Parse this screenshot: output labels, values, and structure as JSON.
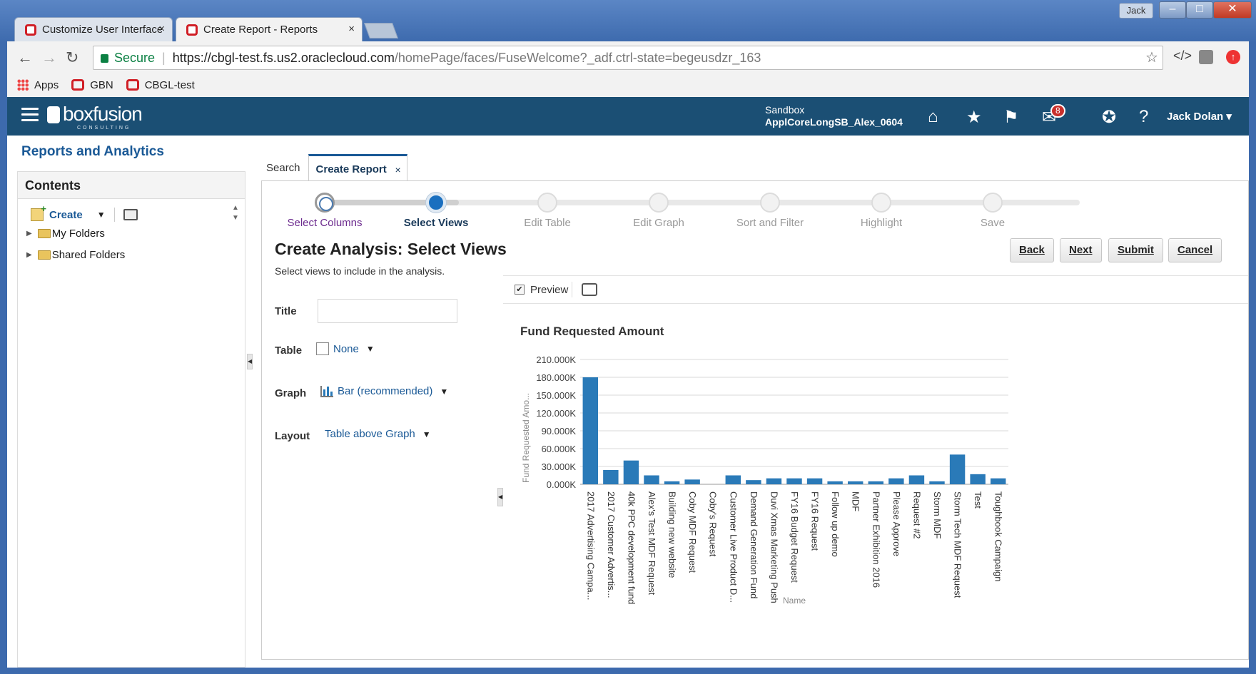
{
  "window": {
    "user_button": "Jack",
    "tabs": [
      {
        "label": "Customize User Interface",
        "close": "×"
      },
      {
        "label": "Create Report - Reports",
        "close": "×"
      }
    ]
  },
  "browser": {
    "secure_label": "Secure",
    "url_host": "https://cbgl-test.fs.us2.oraclecloud.com",
    "url_path": "/homePage/faces/FuseWelcome?_adf.ctrl-state=begeusdzr_163",
    "bookmarks": [
      "Apps",
      "GBN",
      "CBGL-test"
    ]
  },
  "header": {
    "logo_text": "boxfusion",
    "logo_sub": "CONSULTING",
    "sandbox_label": "Sandbox",
    "sandbox_name": "ApplCoreLongSB_Alex_0604",
    "notification_count": "8",
    "user_name": "Jack Dolan"
  },
  "page_title": "Reports and Analytics",
  "left_panel": {
    "heading": "Contents",
    "create_label": "Create",
    "tree": [
      "My Folders",
      "Shared Folders"
    ]
  },
  "content_tabs": [
    {
      "label": "Search"
    },
    {
      "label": "Create Report",
      "close": "×"
    }
  ],
  "train": {
    "steps": [
      "Select Columns",
      "Select Views",
      "Edit Table",
      "Edit Graph",
      "Sort and Filter",
      "Highlight",
      "Save"
    ],
    "current_step": "Select Views",
    "visited_steps": [
      "Select Columns"
    ]
  },
  "analysis": {
    "title": "Create Analysis: Select Views",
    "subtitle": "Select views to include in the analysis.",
    "buttons": [
      "Back",
      "Next",
      "Submit",
      "Cancel"
    ],
    "fields": {
      "title_label": "Title",
      "title_value": "",
      "table_label": "Table",
      "table_value": "None",
      "graph_label": "Graph",
      "graph_value": "Bar (recommended)",
      "layout_label": "Layout",
      "layout_value": "Table above Graph"
    },
    "preview_label": "Preview",
    "preview_checked": true
  },
  "chart_data": {
    "type": "bar",
    "title": "Fund Requested Amount",
    "xlabel": "Name",
    "ylabel": "Fund Requested Amo...",
    "ylim": [
      0,
      210000
    ],
    "yticks": [
      "0.000K",
      "30.000K",
      "60.000K",
      "90.000K",
      "120.000K",
      "150.000K",
      "180.000K",
      "210.000K"
    ],
    "color": "#2a7ab8",
    "categories": [
      "2017 Advertising Campa...",
      "2017 Customer Advertis...",
      "40k PPC development fund",
      "Alex's Test MDF Request",
      "Building new website",
      "Coby MDF Request",
      "Coby's Request",
      "Customer Live Product D...",
      "Demand Generation Fund",
      "Duvi Xmas Marketing Push",
      "FY16 Budget Request",
      "FY16 Request",
      "Follow up demo",
      "MDF",
      "Partner Exhibition 2016",
      "Please Approve",
      "Request #2",
      "Storm MDF",
      "Storm Tech MDF Request",
      "Test",
      "Toughbook Campaign"
    ],
    "values": [
      180000,
      24000,
      40000,
      15000,
      5000,
      8000,
      0,
      15000,
      7000,
      10000,
      10000,
      10000,
      5000,
      5000,
      5000,
      10000,
      15000,
      5000,
      50000,
      17000,
      10000
    ]
  }
}
